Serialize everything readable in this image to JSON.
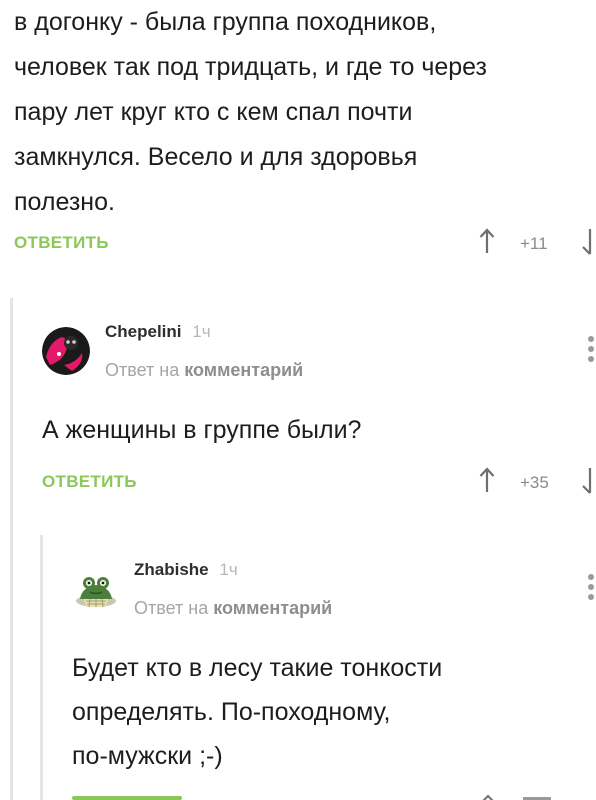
{
  "top_comment": {
    "lines": [
      "в догонку - была группа походников,",
      "человек так под тридцать, и где то через",
      "пару лет круг кто с кем спал почти",
      "замкнулся. Весело и для здоровья",
      "полезно."
    ],
    "reply_label": "ОТВЕТИТЬ",
    "rating": "+11"
  },
  "comment_1": {
    "author": "Chepelini",
    "time": "1ч",
    "reply_to_prefix": "Ответ на",
    "reply_to_link": "комментарий",
    "text": "А женщины в группе были?",
    "reply_label": "ОТВЕТИТЬ",
    "rating": "+35"
  },
  "comment_2": {
    "author": "Zhabishe",
    "time": "1ч",
    "reply_to_prefix": "Ответ на",
    "reply_to_link": "комментарий",
    "lines": [
      "Будет кто в лесу такие тонкости",
      "определять. По-походному,",
      "по-мужски ;-)"
    ]
  },
  "colors": {
    "reply_green": "#8ac858",
    "thread_line": "#e4e4e4",
    "meta_gray": "#a5a5a5"
  }
}
